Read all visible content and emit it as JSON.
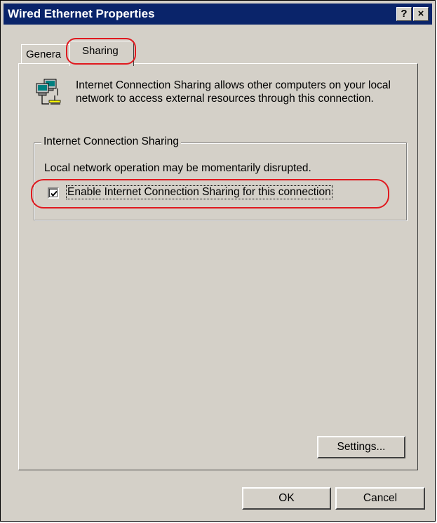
{
  "window": {
    "title": "Wired Ethernet Properties",
    "help_button": "?",
    "close_button": "×"
  },
  "tabs": [
    {
      "label": "Genera",
      "active": false
    },
    {
      "label": "Sharing",
      "active": true
    }
  ],
  "sharing": {
    "description": "Internet Connection Sharing allows other computers on your local network to access external resources through this connection.",
    "group_title": "Internet Connection Sharing",
    "disruption_note": "Local network operation may be momentarily disrupted.",
    "enable_checkbox": {
      "label": "Enable Internet Connection Sharing for this connection",
      "checked": true
    },
    "settings_button": "Settings..."
  },
  "footer": {
    "ok_label": "OK",
    "cancel_label": "Cancel"
  },
  "icons": {
    "network": "network-connection-icon"
  },
  "colors": {
    "titlebar": "#0a246a",
    "highlight": "#e0191f",
    "face": "#d4d0c8"
  }
}
